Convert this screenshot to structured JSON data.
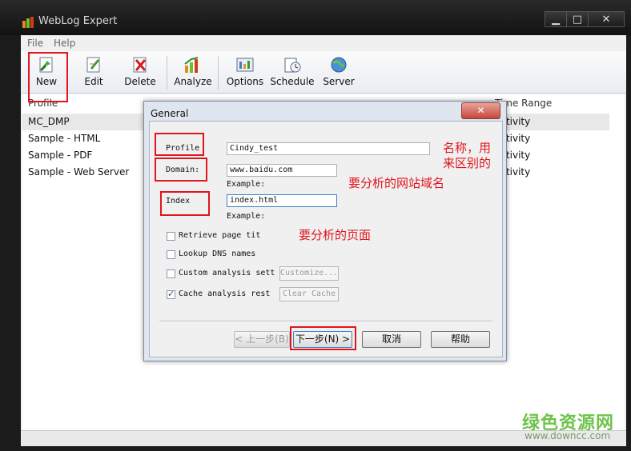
{
  "window": {
    "title": "WebLog Expert",
    "controls": [
      "▁",
      "□",
      "✕"
    ]
  },
  "menu": [
    "File",
    "Help"
  ],
  "toolbar": {
    "buttons": [
      {
        "label": "New",
        "icon": "new-profile-icon"
      },
      {
        "label": "Edit",
        "icon": "edit-profile-icon"
      },
      {
        "label": "Delete",
        "icon": "delete-profile-icon"
      },
      {
        "label": "Analyze",
        "icon": "analyze-icon"
      },
      {
        "label": "Options",
        "icon": "options-icon"
      },
      {
        "label": "Schedule",
        "icon": "schedule-icon"
      },
      {
        "label": "Server",
        "icon": "server-icon"
      }
    ]
  },
  "list": {
    "columns": [
      "Profile",
      "Time Range"
    ],
    "rows": [
      {
        "name": "MC_DMP",
        "range": "activity"
      },
      {
        "name": "Sample - HTML",
        "range": "activity"
      },
      {
        "name": "Sample - PDF",
        "range": "activity"
      },
      {
        "name": "Sample - Web Server",
        "range": "activity"
      }
    ]
  },
  "dialog": {
    "title": "General",
    "close": "✕",
    "profile_label": "Profile",
    "profile_value": "Cindy_test",
    "domain_label": "Domain:",
    "domain_value": "www.baidu.com",
    "domain_example": "Example:",
    "index_label": "Index",
    "index_value": "index.html",
    "index_example": "Example:",
    "options": [
      {
        "label": "Retrieve page tit",
        "checked": false
      },
      {
        "label": "Lookup DNS names",
        "checked": false
      },
      {
        "label": "Custom analysis sett",
        "checked": false
      },
      {
        "label": "Cache analysis rest",
        "checked": true
      }
    ],
    "customize_btn": "Customize...",
    "clear_cache_btn": "Clear Cache",
    "back_btn": "< 上一步(B)",
    "next_btn": "下一步(N) >",
    "cancel_btn": "取消",
    "help_btn": "帮助"
  },
  "annotations": {
    "name_line1": "名称，用",
    "name_line2": "来区别的",
    "domain_note": "要分析的网站域名",
    "page_note": "要分析的页面"
  },
  "watermark": {
    "brand": "绿色资源网",
    "url": "www.downcc.com"
  },
  "colors": {
    "annotation_red": "#e2141c",
    "watermark_green": "#6ec34a"
  }
}
